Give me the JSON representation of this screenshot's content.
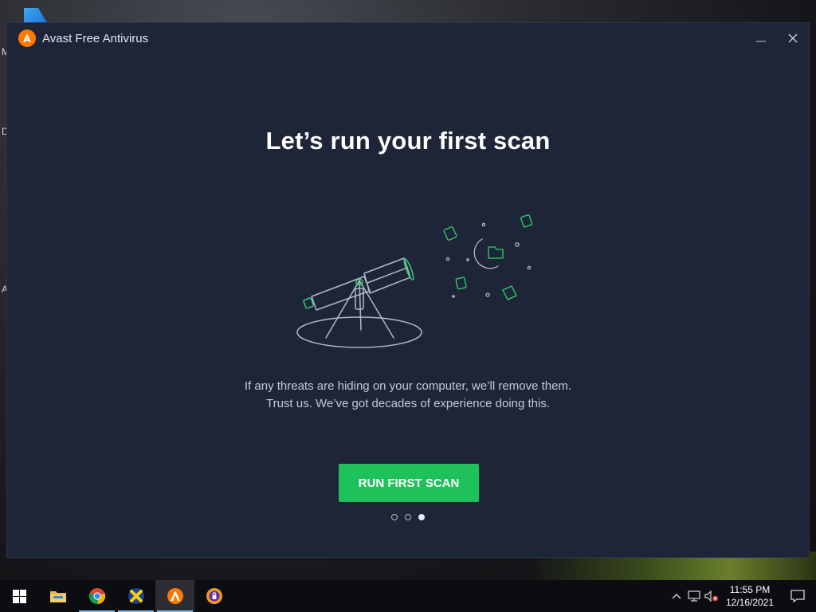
{
  "window": {
    "title": "Avast Free Antivirus",
    "minimize_glyph": "—",
    "close_glyph": "✕"
  },
  "main": {
    "headline": "Let’s run your first scan",
    "description_line1": "If any threats are hiding on your computer, we’ll remove them.",
    "description_line2": "Trust us. We’ve got decades of experience doing this.",
    "cta_label": "RUN FIRST SCAN",
    "pagination": {
      "total": 3,
      "active_index": 2
    }
  },
  "desktop": {
    "left_letters": [
      "M",
      "D",
      "A"
    ]
  },
  "taskbar": {
    "apps": [
      {
        "name": "file-explorer-icon"
      },
      {
        "name": "chrome-icon"
      },
      {
        "name": "x-app-icon"
      },
      {
        "name": "avast-icon"
      },
      {
        "name": "avast-secure-browser-icon"
      }
    ],
    "tray": {
      "chevron": "^",
      "time": "11:55 PM",
      "date": "12/16/2021"
    }
  },
  "colors": {
    "window_bg": "#1f2539",
    "accent_green": "#1fc15a",
    "avast_orange": "#ff7800",
    "illustration_line": "#b3b8c9",
    "illustration_green": "#2bd46e"
  }
}
